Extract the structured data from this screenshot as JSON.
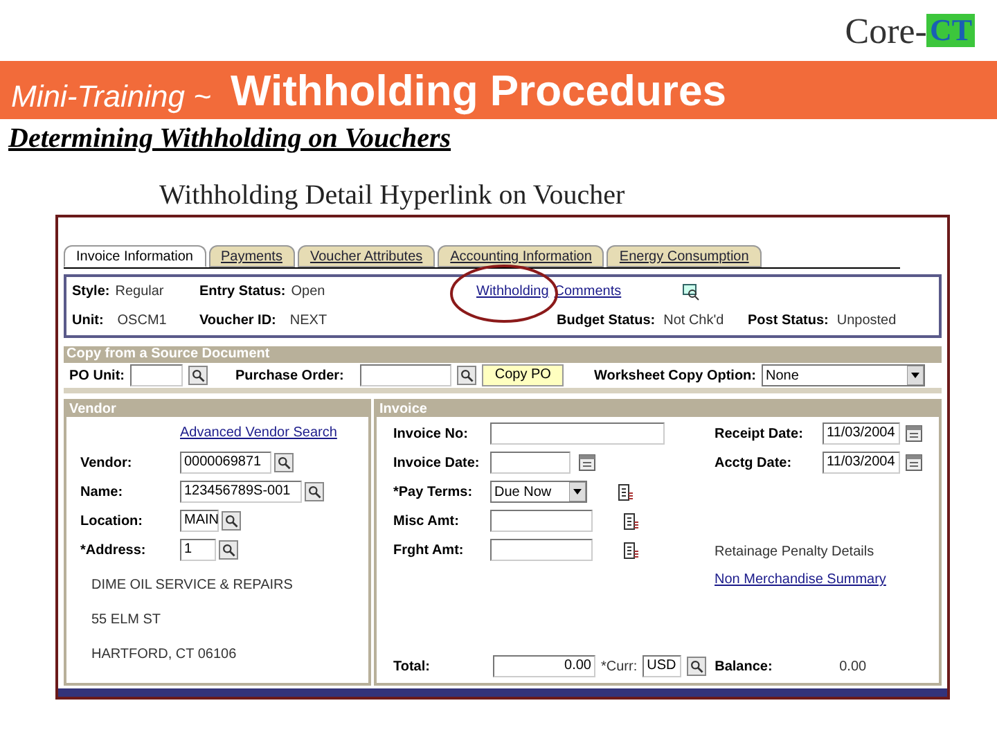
{
  "logo": {
    "text": "Core-",
    "badge": "CT"
  },
  "banner": {
    "prefix": "Mini-Training ~",
    "title": "Withholding Procedures"
  },
  "subtitle": "Determining Withholding on Vouchers",
  "caption": "Withholding Detail Hyperlink on Voucher",
  "screen": {
    "tabs": [
      {
        "label": "Invoice Information",
        "selected": true
      },
      {
        "label": "Payments",
        "selected": false
      },
      {
        "label": "Voucher Attributes",
        "selected": false
      },
      {
        "label": "Accounting Information",
        "selected": false
      },
      {
        "label": "Energy Consumption",
        "selected": false
      }
    ],
    "header_row_1": [
      {
        "label": "Style:",
        "value": "Regular"
      },
      {
        "label": "Entry Status:",
        "value": "Open"
      }
    ],
    "header_links": [
      "Withholding",
      "Comments"
    ],
    "header_row_2": [
      {
        "label": "Unit:",
        "value": "OSCM1"
      },
      {
        "label": "Voucher ID:",
        "value": "NEXT"
      }
    ],
    "header_row_2_right": [
      {
        "label": "Budget Status:",
        "value": "Not Chk'd"
      },
      {
        "label": "Post Status:",
        "value": "Unposted"
      }
    ],
    "copy_section": {
      "title": "Copy from a Source Document",
      "po_unit_label": "PO Unit:",
      "purchase_order_label": "Purchase Order:",
      "copy_button": "Copy PO",
      "worksheet_label": "Worksheet Copy Option:",
      "worksheet_value": "None"
    },
    "vendor": {
      "title": "Vendor",
      "link": "Advanced Vendor Search",
      "fields": [
        {
          "label": "Vendor:",
          "value": "0000069871"
        },
        {
          "label": "Name:",
          "value": "123456789S-001"
        },
        {
          "label": "Location:",
          "value": "MAIN"
        },
        {
          "label": "*Address:",
          "value": "1"
        }
      ],
      "address_lines": [
        "DIME OIL SERVICE & REPAIRS",
        "55 ELM ST",
        "HARTFORD, CT 06106"
      ]
    },
    "invoice": {
      "title": "Invoice",
      "fields": [
        {
          "label": "Invoice No:",
          "kind": "text",
          "notes": false
        },
        {
          "label": "Invoice Date:",
          "kind": "date",
          "notes": false
        },
        {
          "label": "*Pay Terms:",
          "kind": "select",
          "value": "Due Now",
          "notes": true
        },
        {
          "label": "Misc Amt:",
          "kind": "text",
          "notes": true
        },
        {
          "label": "Frght Amt:",
          "kind": "text",
          "notes": true
        }
      ],
      "dates": [
        {
          "label": "Receipt Date:",
          "value": "11/03/2004"
        },
        {
          "label": "Acctg Date:",
          "value": "11/03/2004"
        }
      ],
      "penalty_text": "Retainage Penalty Details",
      "summary_link": "Non Merchandise Summary",
      "total_label": "Total:",
      "total_value": "0.00",
      "currency_label": "*Curr:",
      "currency_value": "USD",
      "balance_label": "Balance:",
      "balance_value": "0.00"
    }
  }
}
